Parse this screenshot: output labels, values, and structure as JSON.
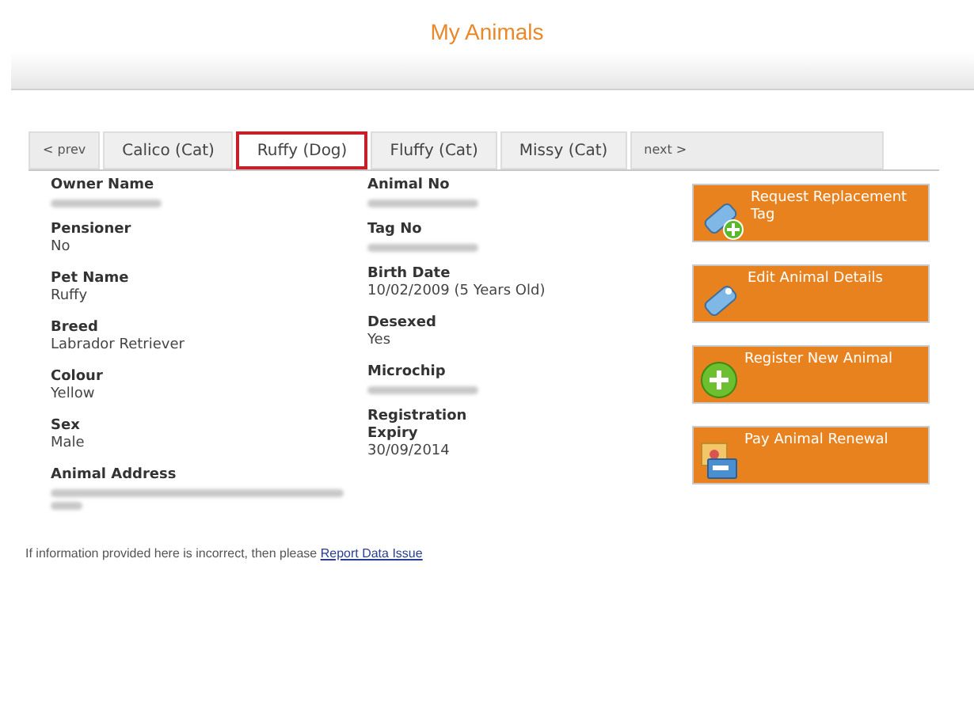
{
  "page_title": "My Animals",
  "tabs": [
    {
      "label": "< prev",
      "kind": "nav",
      "selected": false
    },
    {
      "label": "Calico (Cat)",
      "kind": "animal",
      "selected": false
    },
    {
      "label": "Ruffy (Dog)",
      "kind": "animal",
      "selected": true
    },
    {
      "label": "Fluffy (Cat)",
      "kind": "animal",
      "selected": false
    },
    {
      "label": "Missy (Cat)",
      "kind": "animal",
      "selected": false
    },
    {
      "label": "next >",
      "kind": "nav",
      "selected": false
    }
  ],
  "details_left": [
    {
      "label": "Owner Name",
      "kind": "redacted"
    },
    {
      "label": "Pensioner",
      "kind": "text",
      "value": "No"
    },
    {
      "label": "Pet Name",
      "kind": "text",
      "value": "Ruffy"
    },
    {
      "label": "Breed",
      "kind": "text",
      "value": "Labrador Retriever"
    },
    {
      "label": "Colour",
      "kind": "text",
      "value": "Yellow"
    },
    {
      "label": "Sex",
      "kind": "text",
      "value": "Male"
    },
    {
      "label": "Animal Address",
      "kind": "redacted-multiline"
    }
  ],
  "details_right": [
    {
      "label": "Animal No",
      "kind": "redacted"
    },
    {
      "label": "Tag No",
      "kind": "redacted"
    },
    {
      "label": "Birth Date",
      "kind": "text",
      "value": "10/02/2009 (5 Years Old)"
    },
    {
      "label": "Desexed",
      "kind": "text",
      "value": "Yes"
    },
    {
      "label": "Microchip",
      "kind": "redacted"
    },
    {
      "label": "Registration Expiry",
      "kind": "text",
      "value": "30/09/2014"
    }
  ],
  "actions": [
    {
      "label": "Request Replacement Tag",
      "kind": "tag-add"
    },
    {
      "label": "Edit Animal Details",
      "kind": "tag"
    },
    {
      "label": "Register New Animal",
      "kind": "plus"
    },
    {
      "label": "Pay Animal Renewal",
      "kind": "card"
    }
  ],
  "footer": {
    "text": "If information provided here is incorrect, then please",
    "link": "Report Data Issue"
  }
}
